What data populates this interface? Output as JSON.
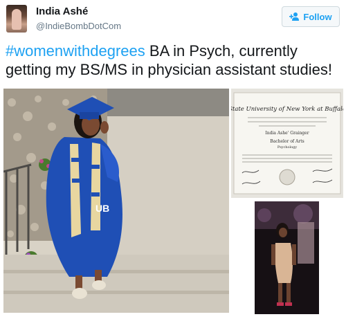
{
  "author": {
    "name": "India Ashé",
    "handle": "@IndieBombDotCom"
  },
  "follow_button": {
    "label": "Follow",
    "icon": "add-user-icon"
  },
  "tweet": {
    "hashtag": "#womenwithdegrees",
    "body": " BA in Psych, currently getting my BS/MS in physician assistant studies!"
  },
  "media": [
    {
      "name": "graduation-photo",
      "gown_text": "UB"
    },
    {
      "name": "diploma-photo",
      "diploma_title": "State University of New York at Buffalo",
      "degree": "Bachelor of Arts",
      "recipient": "India Ashe' Grainger",
      "field": "Psychology"
    },
    {
      "name": "party-photo"
    }
  ],
  "colors": {
    "link": "#1da1f2",
    "text": "#14171a",
    "secondary": "#657786",
    "gown": "#1f4fb5"
  }
}
